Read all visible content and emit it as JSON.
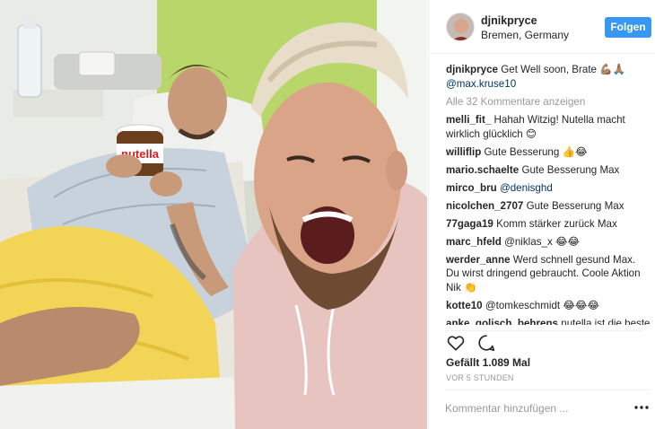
{
  "post": {
    "username": "djnikpryce",
    "location": "Bremen, Germany",
    "follow_label": "Folgen"
  },
  "caption": {
    "user": "djnikpryce",
    "text": "Get Well soon, Brate",
    "emoji": "💪🏽🙏🏽",
    "mention": "@max.kruse10"
  },
  "view_all": "Alle 32 Kommentare anzeigen",
  "comments": [
    {
      "user": "melli_fit_",
      "text": "Hahah Witzig! Nutella macht wirklich glücklich 😊"
    },
    {
      "user": "williflip",
      "text": "Gute Besserung 👍😂"
    },
    {
      "user": "mario.schaelte",
      "text": "Gute Besserung Max"
    },
    {
      "user": "mirco_bru",
      "text": "@denisghd"
    },
    {
      "user": "nicolchen_2707",
      "text": "Gute Besserung Max"
    },
    {
      "user": "77gaga19",
      "text": "Komm stärker zurück Max"
    },
    {
      "user": "marc_hfeld",
      "text": "@niklas_x 😂😂"
    },
    {
      "user": "werder_anne",
      "text": "Werd schnell gesund Max. Du wirst dringend gebraucht. Coole Aktion Nik 👏"
    },
    {
      "user": "kotte10",
      "text": "@tomkeschmidt 😂😂😂"
    },
    {
      "user": "anke_golisch_behrens",
      "text": "nutella ist die beste Medizin!!😂 gute Besserung 👍😂"
    }
  ],
  "likes": "Gefällt 1.089 Mal",
  "timestamp": "VOR 5 STUNDEN",
  "add_comment_placeholder": "Kommentar hinzufügen ...",
  "nutella_label": "nutella",
  "icons": {
    "like": "heart-icon",
    "comment": "comment-icon",
    "more": "more-options-icon"
  },
  "colors": {
    "follow_button": "#3897f0",
    "mention": "#003569",
    "muted": "#999999"
  }
}
